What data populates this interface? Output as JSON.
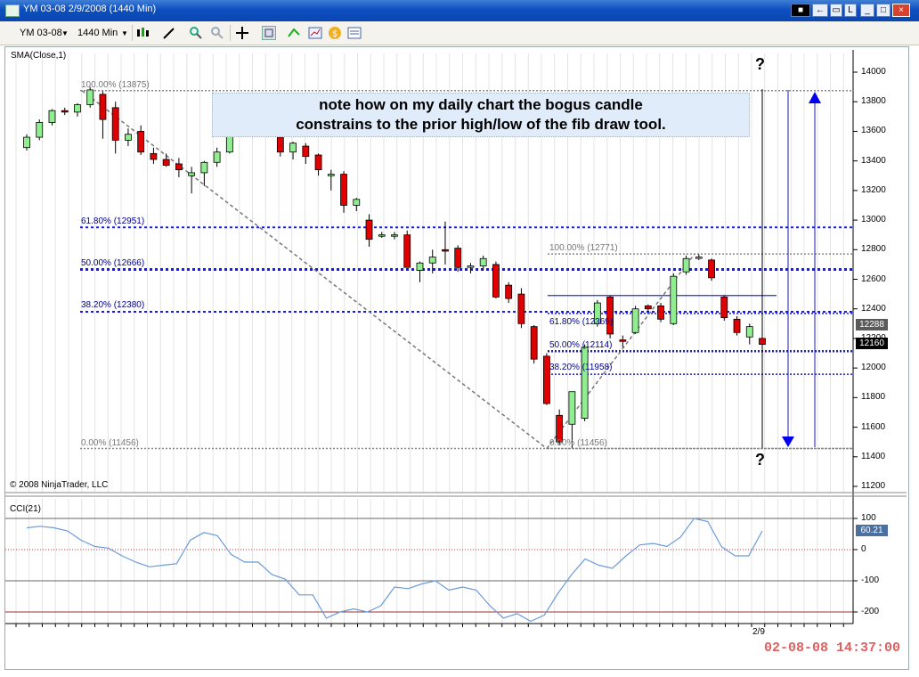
{
  "window": {
    "title": "YM 03-08  2/9/2008 (1440 Min)",
    "buttons": [
      "←",
      "L",
      "_",
      "□",
      "×"
    ]
  },
  "toolbar": {
    "instrument": "YM 03-08",
    "period": "1440 Min",
    "icons": [
      "candlestick-icon",
      "pencil-icon",
      "zoom-in-icon",
      "zoom-out-icon",
      "crosshair-icon",
      "properties-icon",
      "strategy-icon",
      "chart-icon",
      "dollar-icon",
      "data-box-icon"
    ]
  },
  "chart": {
    "indicator_label": "SMA(Close,1)",
    "cci_label": "CCI(21)",
    "copyright": "© 2008 NinjaTrader, LLC",
    "note_line1": "note how on my daily chart the bogus candle",
    "note_line2": "constrains to the prior high/low of the fib draw tool.",
    "question_mark": "?",
    "date_label": "2/9",
    "timestamp": "02-08-08 14:37:00",
    "price_ticks": [
      "14000",
      "13800",
      "13600",
      "13400",
      "13200",
      "13000",
      "12800",
      "12600",
      "12400",
      "12200",
      "12000",
      "11800",
      "11600",
      "11400",
      "11200"
    ],
    "cci_ticks": [
      "100",
      "0",
      "-100",
      "-200"
    ],
    "price_tags": [
      {
        "text": "12288",
        "color": "#5a5a5a"
      },
      {
        "text": "12160",
        "color": "#000000"
      }
    ],
    "cci_tag": {
      "text": "60.21",
      "color": "#4a6fa0"
    },
    "fib_large": [
      "100.00% (13875)",
      "61.80% (12951)",
      "50.00% (12666)",
      "38.20% (12380)",
      "0.00% (11456)"
    ],
    "fib_small": [
      "100.00% (12771)",
      "61.80% (12369)",
      "50.00% (12114)",
      "38.20% (11958)",
      "0.00% (11456)"
    ]
  },
  "chart_data": {
    "type": "candlestick",
    "y_range": [
      11100,
      14100
    ],
    "candles": [
      [
        13490,
        13580,
        13470,
        13560
      ],
      [
        13560,
        13680,
        13540,
        13660
      ],
      [
        13660,
        13750,
        13640,
        13740
      ],
      [
        13740,
        13760,
        13710,
        13730
      ],
      [
        13730,
        13790,
        13700,
        13780
      ],
      [
        13780,
        13900,
        13760,
        13880
      ],
      [
        13850,
        13870,
        13550,
        13680
      ],
      [
        13760,
        13800,
        13450,
        13540
      ],
      [
        13540,
        13620,
        13500,
        13580
      ],
      [
        13600,
        13640,
        13440,
        13460
      ],
      [
        13450,
        13490,
        13380,
        13410
      ],
      [
        13410,
        13450,
        13360,
        13370
      ],
      [
        13380,
        13420,
        13290,
        13340
      ],
      [
        13300,
        13360,
        13180,
        13320
      ],
      [
        13320,
        13400,
        13230,
        13390
      ],
      [
        13390,
        13490,
        13360,
        13460
      ],
      [
        13460,
        13580,
        13450,
        13570
      ],
      [
        13570,
        13650,
        13560,
        13640
      ],
      [
        13640,
        13660,
        13620,
        13630
      ],
      [
        13620,
        13640,
        13560,
        13580
      ],
      [
        13560,
        13590,
        13430,
        13460
      ],
      [
        13460,
        13530,
        13410,
        13520
      ],
      [
        13500,
        13520,
        13380,
        13430
      ],
      [
        13440,
        13450,
        13300,
        13340
      ],
      [
        13300,
        13340,
        13200,
        13310
      ],
      [
        13310,
        13330,
        13050,
        13100
      ],
      [
        13100,
        13150,
        13060,
        13140
      ],
      [
        13000,
        13040,
        12820,
        12870
      ],
      [
        12900,
        12920,
        12880,
        12900
      ],
      [
        12900,
        12920,
        12870,
        12900
      ],
      [
        12900,
        12930,
        12680,
        12680
      ],
      [
        12660,
        12720,
        12580,
        12710
      ],
      [
        12710,
        12800,
        12640,
        12750
      ],
      [
        12800,
        12990,
        12700,
        12790
      ],
      [
        12810,
        12830,
        12650,
        12680
      ],
      [
        12680,
        12710,
        12640,
        12690
      ],
      [
        12690,
        12760,
        12660,
        12740
      ],
      [
        12700,
        12720,
        12470,
        12480
      ],
      [
        12560,
        12580,
        12440,
        12470
      ],
      [
        12500,
        12540,
        12270,
        12300
      ],
      [
        12280,
        12290,
        12030,
        12060
      ],
      [
        12080,
        12100,
        11750,
        11760
      ],
      [
        11680,
        11720,
        11480,
        11500
      ],
      [
        11620,
        11840,
        11460,
        11840
      ],
      [
        11660,
        12160,
        11640,
        12140
      ],
      [
        12300,
        12460,
        12280,
        12440
      ],
      [
        12480,
        12490,
        12200,
        12230
      ],
      [
        12190,
        12220,
        12140,
        12180
      ],
      [
        12240,
        12420,
        12230,
        12400
      ],
      [
        12420,
        12430,
        12380,
        12400
      ],
      [
        12420,
        12440,
        12310,
        12330
      ],
      [
        12300,
        12640,
        12290,
        12620
      ],
      [
        12650,
        12760,
        12630,
        12740
      ],
      [
        12750,
        12770,
        12730,
        12750
      ],
      [
        12730,
        12740,
        12590,
        12610
      ],
      [
        12480,
        12490,
        12320,
        12340
      ],
      [
        12330,
        12350,
        12220,
        12240
      ],
      [
        12210,
        12300,
        12160,
        12280
      ],
      [
        12200,
        12230,
        12140,
        12160
      ]
    ],
    "cci": [
      70,
      75,
      70,
      60,
      30,
      10,
      5,
      -20,
      -40,
      -55,
      -50,
      -45,
      30,
      55,
      45,
      -15,
      -40,
      -40,
      -80,
      -95,
      -145,
      -145,
      -220,
      -200,
      -190,
      -200,
      -180,
      -120,
      -125,
      -110,
      -100,
      -130,
      -120,
      -130,
      -180,
      -220,
      -205,
      -230,
      -210,
      -140,
      -80,
      -30,
      -50,
      -60,
      -20,
      15,
      20,
      10,
      40,
      100,
      90,
      10,
      -20,
      -20,
      60
    ],
    "fib_large_levels": [
      13875,
      12951,
      12666,
      12380,
      11456
    ],
    "fib_small_levels": [
      12771,
      12369,
      12114,
      11958,
      11456
    ],
    "fib_small_extra_line": 12490
  }
}
